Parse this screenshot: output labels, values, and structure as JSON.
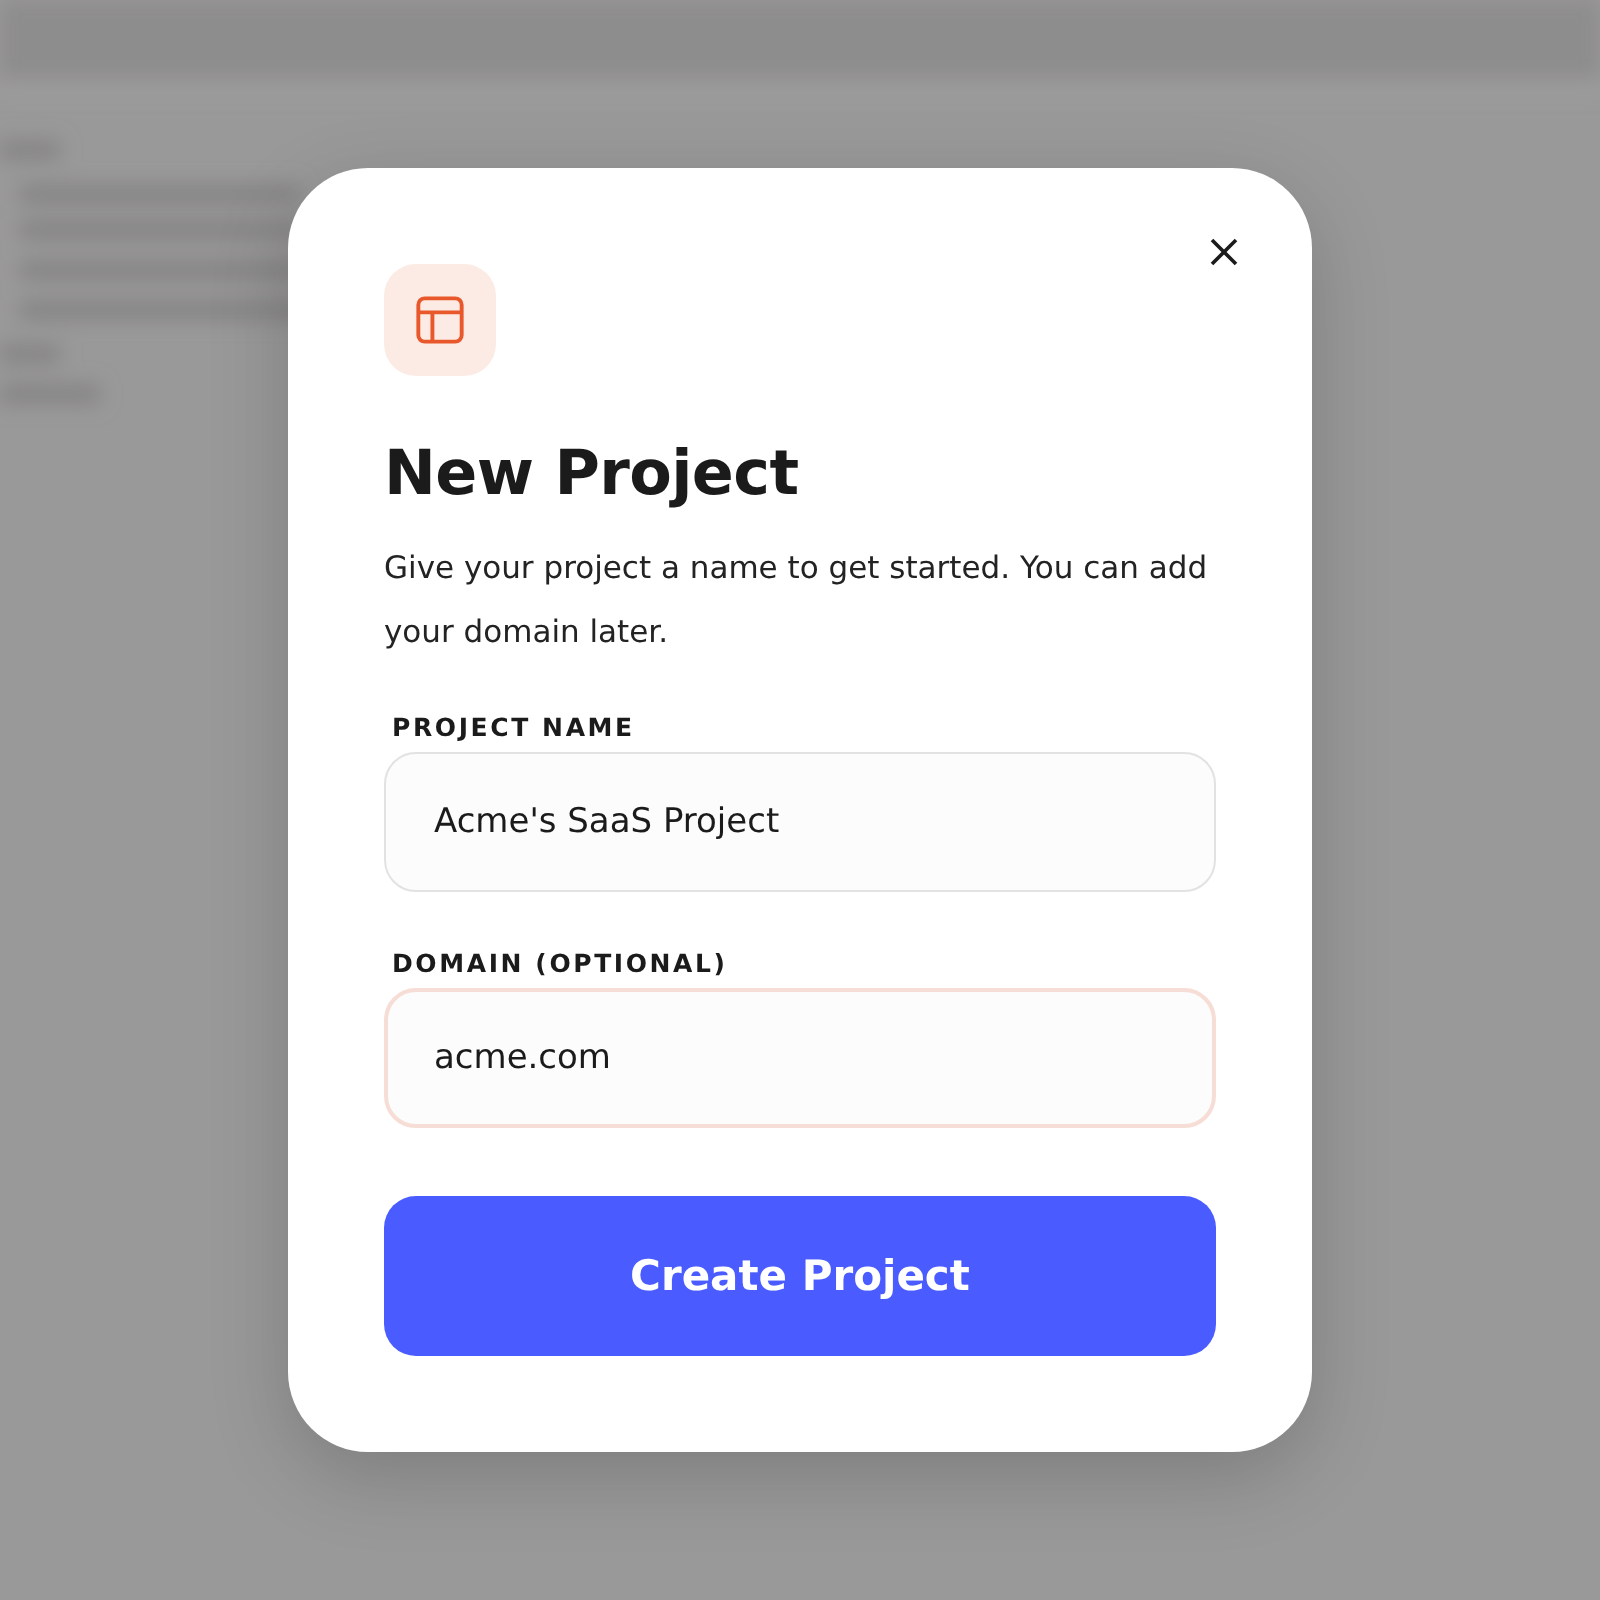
{
  "dialog": {
    "title": "New Project",
    "description": "Give your project a name to get started. You can add your domain later.",
    "fields": [
      {
        "label": "PROJECT NAME",
        "value": "Acme's SaaS Project",
        "focused": false
      },
      {
        "label": "DOMAIN (OPTIONAL)",
        "value": "acme.com",
        "focused": true
      }
    ],
    "submit": "Create Project"
  }
}
